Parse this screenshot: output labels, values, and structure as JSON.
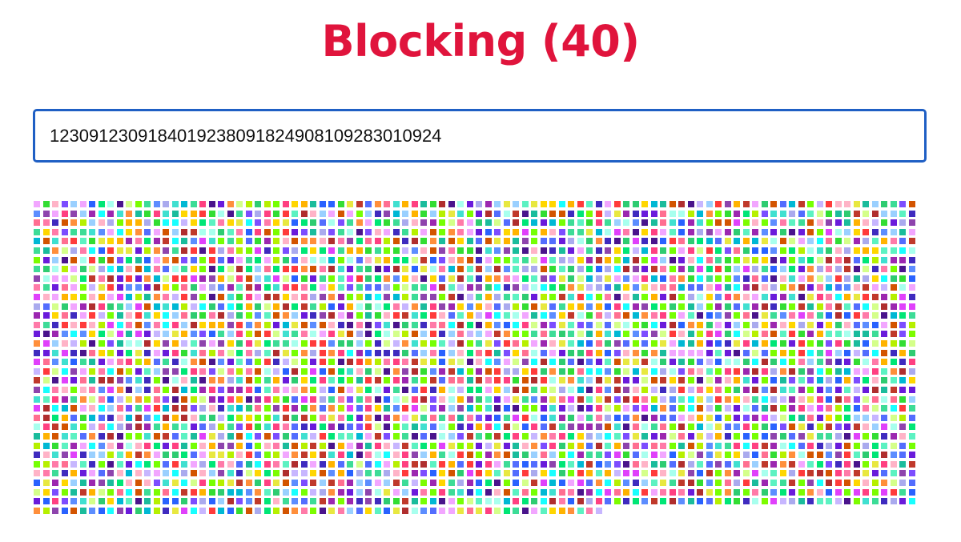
{
  "page": {
    "title": "Blocking (40)"
  },
  "search": {
    "value": "1230912309184019238091824908109283010924"
  },
  "grid": {
    "columns": 96,
    "rows": 34,
    "count": 3230,
    "palette": [
      "#ff3b3b",
      "#ff7aa8",
      "#e040fb",
      "#9c27b0",
      "#6a1bdb",
      "#3f2bbf",
      "#2962ff",
      "#5c8dff",
      "#00b8d4",
      "#40e0d0",
      "#5cf2c2",
      "#2ecc71",
      "#33dd33",
      "#7cfc00",
      "#b6f000",
      "#e8e840",
      "#ffd600",
      "#ffb300",
      "#ff8f3b",
      "#d35400",
      "#c0392b",
      "#b02e2e",
      "#8e44ad",
      "#aaaaee",
      "#c7b6ff",
      "#ffb3c7",
      "#f2a6ff",
      "#9ad0ff",
      "#a8ffee",
      "#d4ff8a",
      "#ff6f91",
      "#3ddc97",
      "#1abc9c",
      "#4a148c",
      "#ff4081",
      "#00e676",
      "#76ff03",
      "#18ffff",
      "#536dfe",
      "#7c4dff"
    ]
  }
}
